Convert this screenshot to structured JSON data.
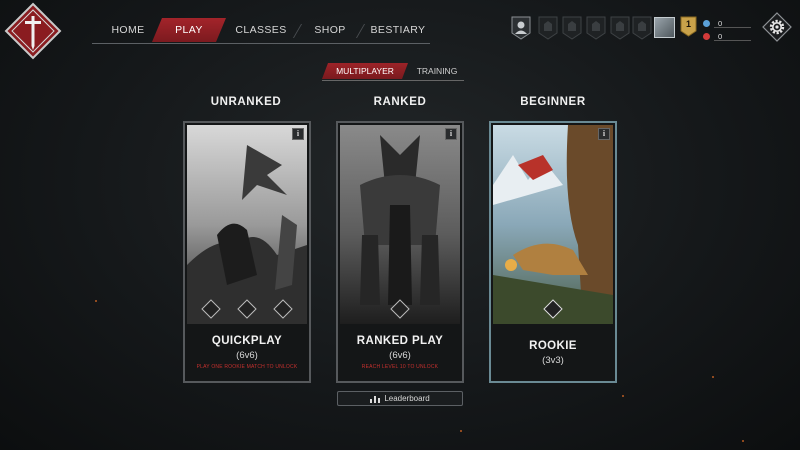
{
  "colors": {
    "accent_red": "#9c2328",
    "brand_bg": "#1c1f21",
    "rookie_border": "#6a8a94",
    "lock_text": "#c6302e"
  },
  "logo": {
    "icon": "sword-icon"
  },
  "nav": {
    "items": [
      {
        "label": "HOME",
        "active": false
      },
      {
        "label": "PLAY",
        "active": true
      },
      {
        "label": "CLASSES",
        "active": false
      },
      {
        "label": "SHOP",
        "active": false
      },
      {
        "label": "BESTIARY",
        "active": false
      }
    ]
  },
  "header": {
    "badges": [
      "player-badge-icon",
      "locked-badge-icon",
      "locked-badge-icon",
      "locked-badge-icon",
      "locked-badge-icon",
      "locked-badge-icon"
    ],
    "level": "1",
    "currency": [
      {
        "icon": "crystal-icon",
        "value": "0",
        "color": "#5aa0d8"
      },
      {
        "icon": "blood-icon",
        "value": "0",
        "color": "#d23a3a"
      }
    ],
    "settings_icon": "gear-icon"
  },
  "subtabs": {
    "items": [
      {
        "label": "MULTIPLAYER",
        "active": true
      },
      {
        "label": "TRAINING",
        "active": false
      }
    ]
  },
  "modes": [
    {
      "heading": "UNRANKED",
      "title": "QUICKPLAY",
      "subtitle": "(6v6)",
      "lock_text": "PLAY ONE ROOKIE MATCH TO UNLOCK",
      "info": "i"
    },
    {
      "heading": "RANKED",
      "title": "RANKED PLAY",
      "subtitle": "(6v6)",
      "lock_text": "REACH LEVEL 10 TO UNLOCK",
      "info": "i"
    },
    {
      "heading": "BEGINNER",
      "title": "ROOKIE",
      "subtitle": "(3v3)",
      "lock_text": "",
      "info": "i"
    }
  ],
  "leaderboard": {
    "label": "Leaderboard"
  }
}
